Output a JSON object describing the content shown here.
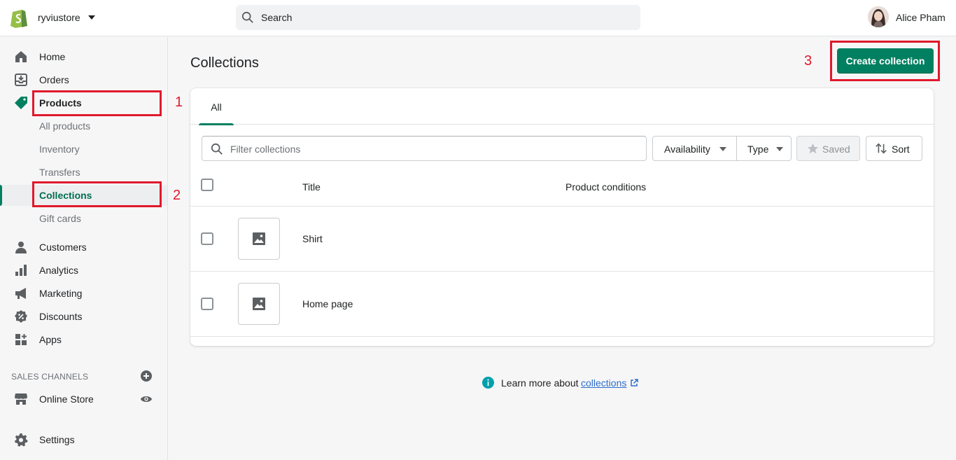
{
  "topbar": {
    "store_name": "ryviustore",
    "search_placeholder": "Search",
    "user_name": "Alice Pham"
  },
  "sidebar": {
    "items": [
      {
        "label": "Home",
        "icon": "home-icon"
      },
      {
        "label": "Orders",
        "icon": "orders-icon"
      },
      {
        "label": "Products",
        "icon": "tag-icon"
      },
      {
        "label": "Customers",
        "icon": "person-icon"
      },
      {
        "label": "Analytics",
        "icon": "bar-chart-icon"
      },
      {
        "label": "Marketing",
        "icon": "megaphone-icon"
      },
      {
        "label": "Discounts",
        "icon": "discount-icon"
      },
      {
        "label": "Apps",
        "icon": "apps-icon"
      }
    ],
    "product_subitems": [
      "All products",
      "Inventory",
      "Transfers",
      "Collections",
      "Gift cards"
    ],
    "sales_channels_title": "SALES CHANNELS",
    "online_store": "Online Store",
    "settings": "Settings",
    "accent_color": "#008060"
  },
  "annotations": [
    "1",
    "2",
    "3"
  ],
  "main": {
    "title": "Collections",
    "create_button": "Create collection",
    "tabs": [
      {
        "label": "All"
      }
    ],
    "filter_placeholder": "Filter collections",
    "filters": {
      "availability": "Availability",
      "type": "Type",
      "saved": "Saved",
      "sort": "Sort"
    },
    "table": {
      "headers": [
        "Title",
        "Product conditions"
      ],
      "rows": [
        {
          "title": "Shirt"
        },
        {
          "title": "Home page"
        }
      ]
    },
    "learn_more": {
      "text": "Learn more about",
      "link": "collections"
    }
  }
}
